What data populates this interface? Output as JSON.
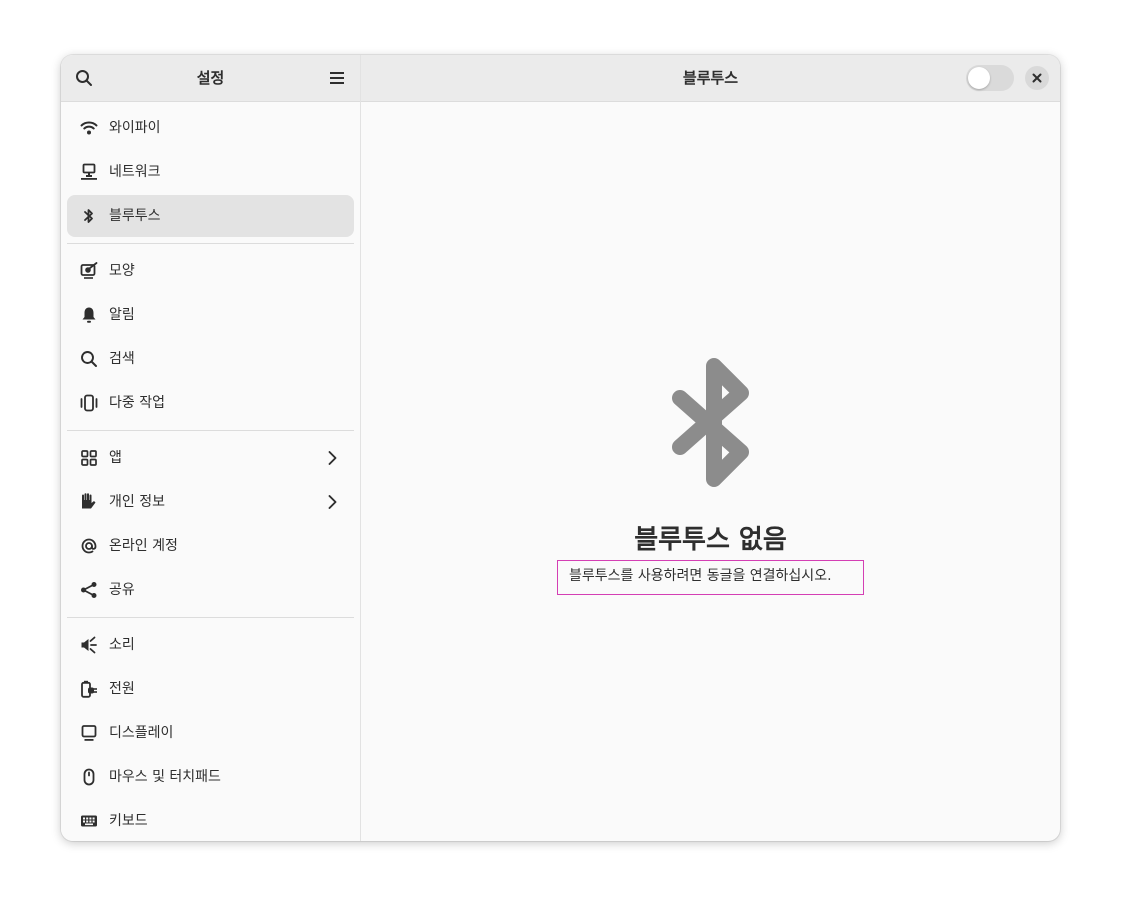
{
  "sidebar": {
    "title": "설정",
    "items": [
      {
        "label": "와이파이",
        "icon": "wifi-icon"
      },
      {
        "label": "네트워크",
        "icon": "network-icon"
      },
      {
        "label": "블루투스",
        "icon": "bluetooth-icon",
        "active": true
      },
      {
        "label": "모양",
        "icon": "appearance-icon"
      },
      {
        "label": "알림",
        "icon": "bell-icon"
      },
      {
        "label": "검색",
        "icon": "search-icon"
      },
      {
        "label": "다중 작업",
        "icon": "multitasking-icon"
      },
      {
        "label": "앱",
        "icon": "apps-icon",
        "has_submenu": true
      },
      {
        "label": "개인 정보",
        "icon": "privacy-hand-icon",
        "has_submenu": true
      },
      {
        "label": "온라인 계정",
        "icon": "at-sign-icon"
      },
      {
        "label": "공유",
        "icon": "share-icon"
      },
      {
        "label": "소리",
        "icon": "speaker-icon"
      },
      {
        "label": "전원",
        "icon": "power-icon"
      },
      {
        "label": "디스플레이",
        "icon": "display-icon"
      },
      {
        "label": "마우스 및 터치패드",
        "icon": "mouse-icon"
      },
      {
        "label": "키보드",
        "icon": "keyboard-icon"
      }
    ]
  },
  "main": {
    "title": "블루투스",
    "toggle_on": false,
    "empty_state": {
      "icon": "bluetooth-icon",
      "title": "블루투스 없음",
      "description": "블루투스를 사용하려면 동글을 연결하십시오."
    }
  },
  "colors": {
    "sidebar_bg": "#fafafa",
    "header_bg": "#ebebeb",
    "active_item_bg": "#e3e3e3",
    "icon_gray": "#8c8c8c",
    "highlight_border": "#d43fb4"
  }
}
